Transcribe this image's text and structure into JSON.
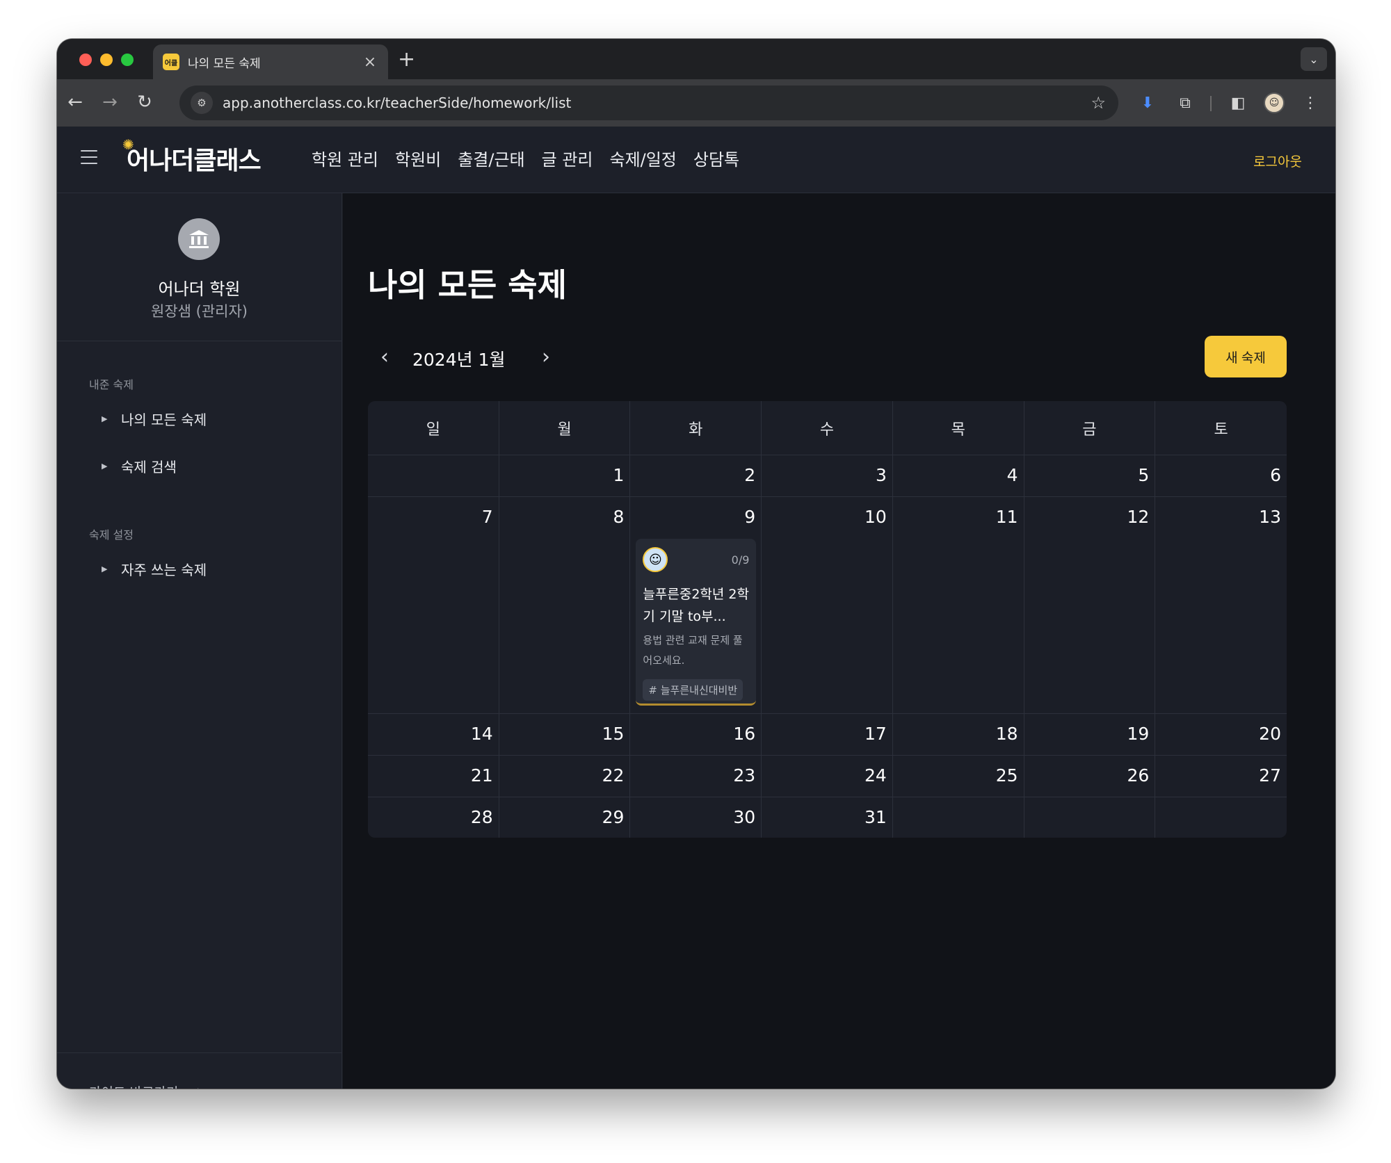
{
  "browser": {
    "tab_title": "나의 모든 숙제",
    "tab_favicon_text": "어클",
    "url": "app.anotherclass.co.kr/teacherSide/homework/list"
  },
  "header": {
    "logo": "어나더클래스",
    "nav": [
      "학원 관리",
      "학원비",
      "출결/근태",
      "글 관리",
      "숙제/일정",
      "상담톡"
    ],
    "logout": "로그아웃"
  },
  "sidebar": {
    "org_name": "어나더 학원",
    "org_role": "원장샘 (관리자)",
    "group1": "내준 숙제",
    "group1_items": [
      "나의 모든 숙제",
      "숙제 검색"
    ],
    "group2": "숙제 설정",
    "group2_items": [
      "자주 쓰는 숙제"
    ],
    "guide": "가이드 바로가기"
  },
  "main": {
    "title": "나의 모든 숙제",
    "month": "2024년 1월",
    "new_button": "새 숙제",
    "weekdays": [
      "일",
      "월",
      "화",
      "수",
      "목",
      "금",
      "토"
    ],
    "weeks": [
      [
        "",
        "1",
        "2",
        "3",
        "4",
        "5",
        "6"
      ],
      [
        "7",
        "8",
        "9",
        "10",
        "11",
        "12",
        "13"
      ],
      [
        "14",
        "15",
        "16",
        "17",
        "18",
        "19",
        "20"
      ],
      [
        "21",
        "22",
        "23",
        "24",
        "25",
        "26",
        "27"
      ],
      [
        "28",
        "29",
        "30",
        "31",
        "",
        "",
        ""
      ]
    ],
    "homework": {
      "count": "0/9",
      "title": "늘푸른중2학년 2학기 기말 to부...",
      "desc": "용법 관련 교재 문제 풀어오세요.",
      "tag": "# 늘푸른내신대비반"
    }
  },
  "colors": {
    "accent": "#f6c93b",
    "background": "#111318",
    "panel": "#1d2029"
  }
}
